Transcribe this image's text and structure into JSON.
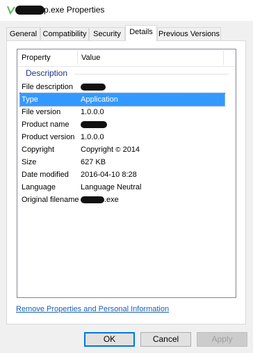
{
  "window": {
    "title_suffix": "p.exe Properties"
  },
  "tabs": [
    {
      "label": "General"
    },
    {
      "label": "Compatibility"
    },
    {
      "label": "Security"
    },
    {
      "label": "Details",
      "active": true
    },
    {
      "label": "Previous Versions"
    }
  ],
  "details": {
    "column_property": "Property",
    "column_value": "Value",
    "group_label": "Description",
    "rows": [
      {
        "property": "File description",
        "value": "",
        "redacted": true
      },
      {
        "property": "Type",
        "value": "Application",
        "selected": true
      },
      {
        "property": "File version",
        "value": "1.0.0.0"
      },
      {
        "property": "Product name",
        "value": "",
        "redacted": true
      },
      {
        "property": "Product version",
        "value": "1.0.0.0"
      },
      {
        "property": "Copyright",
        "value": "Copyright",
        "copyright_symbol": "©",
        "year": "2014"
      },
      {
        "property": "Size",
        "value": "627 KB"
      },
      {
        "property": "Date modified",
        "value": "2016-04-10 8:28"
      },
      {
        "property": "Language",
        "value": "Language Neutral"
      },
      {
        "property": "Original filename",
        "value": ".exe",
        "redacted_prefix": true
      }
    ]
  },
  "link": {
    "label": "Remove Properties and Personal Information"
  },
  "buttons": {
    "ok": "OK",
    "cancel": "Cancel",
    "apply": "Apply"
  },
  "colors": {
    "selection": "#3399ff",
    "group_text": "#1e3287",
    "link": "#1a5fb4",
    "ok_border": "#0078d7"
  }
}
